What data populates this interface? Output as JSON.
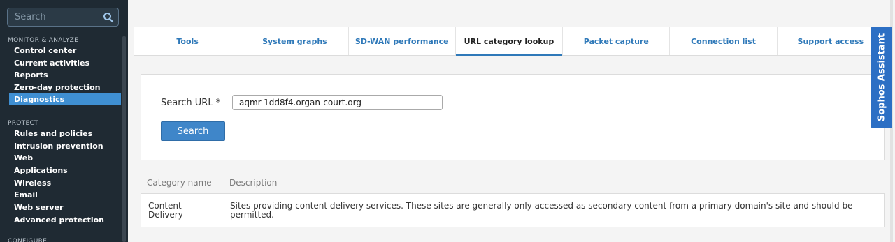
{
  "sidebar": {
    "search_placeholder": "Search",
    "sections": [
      {
        "title": "MONITOR & ANALYZE",
        "items": [
          "Control center",
          "Current activities",
          "Reports",
          "Zero-day protection",
          "Diagnostics"
        ]
      },
      {
        "title": "PROTECT",
        "items": [
          "Rules and policies",
          "Intrusion prevention",
          "Web",
          "Applications",
          "Wireless",
          "Email",
          "Web server",
          "Advanced protection"
        ]
      },
      {
        "title": "CONFIGURE",
        "items": []
      }
    ],
    "active_item": "Diagnostics"
  },
  "tabs": [
    {
      "label": "Tools"
    },
    {
      "label": "System graphs"
    },
    {
      "label": "SD-WAN performance"
    },
    {
      "label": "URL category lookup",
      "active": true
    },
    {
      "label": "Packet capture"
    },
    {
      "label": "Connection list"
    },
    {
      "label": "Support access"
    }
  ],
  "assistant": {
    "label": "Sophos Assistant"
  },
  "lookup": {
    "field_label": "Search URL *",
    "url_value": "aqmr-1dd8f4.organ-court.org",
    "button_label": "Search"
  },
  "results": {
    "headers": [
      "Category name",
      "Description"
    ],
    "rows": [
      {
        "category": "Content Delivery",
        "description": "Sites providing content delivery services. These sites are generally only accessed as secondary content from a primary domain's site and should be permitted."
      }
    ]
  },
  "colors": {
    "sidebar_bg": "#1f2a33",
    "accent": "#3f8fd2",
    "assistant": "#2c6fc4"
  }
}
